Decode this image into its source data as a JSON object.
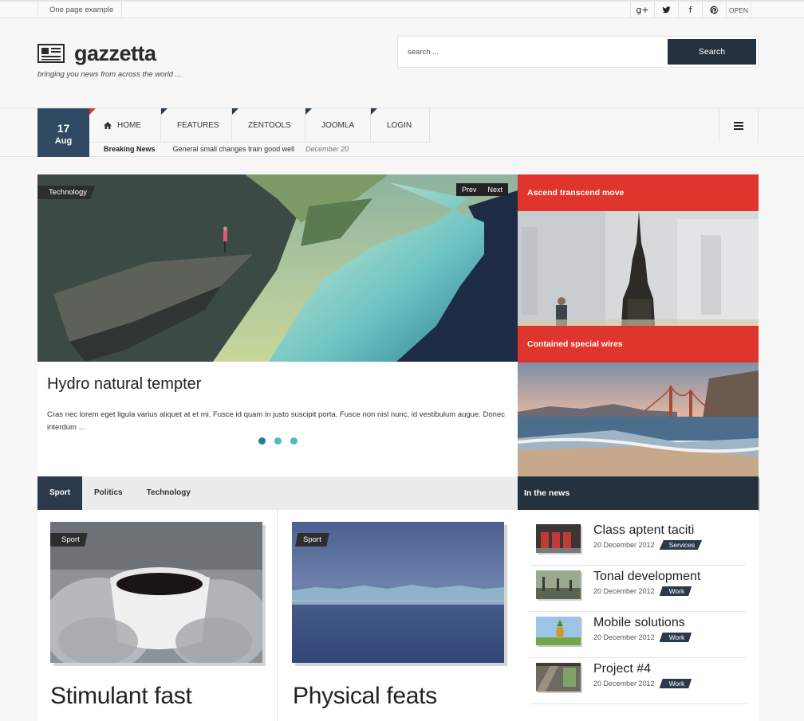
{
  "topbar": {
    "site_label": "One page example",
    "social": [
      {
        "icon": "google-plus-icon",
        "glyph": "g+"
      },
      {
        "icon": "twitter-icon"
      },
      {
        "icon": "facebook-icon",
        "glyph": "f"
      },
      {
        "icon": "pinterest-icon"
      }
    ],
    "open_label": "OPEN"
  },
  "header": {
    "logo_text": "gazzetta",
    "tagline": "bringing you news from across the world ...",
    "search_placeholder": "search ...",
    "search_button": "Search"
  },
  "nav": {
    "date_day": "17",
    "date_month": "Aug",
    "items": [
      "HOME",
      "FEATURES",
      "ZENTOOLS",
      "JOOMLA",
      "LOGIN"
    ],
    "home_icon": "home-icon",
    "menu_icon": "hamburger-icon",
    "breaking_label": "Breaking News",
    "breaking_text": "General small changes train good well",
    "breaking_date": "December 20"
  },
  "slider": {
    "tag": "Technology",
    "prev_label": "Prev",
    "next_label": "Next",
    "title": "Hydro natural tempter",
    "text": "Cras nec lorem eget ligula varius aliquet at et mi. Fusce id quam in justo suscipit porta. Fusce non nisl nunc, id vestibulum augue. Donec interdum ...",
    "dots": 3,
    "active_dot": 0
  },
  "side_features": [
    {
      "title": "Ascend transcend move"
    },
    {
      "title": "Contained special wires"
    }
  ],
  "tabs": {
    "items": [
      "Sport",
      "Politics",
      "Technology"
    ],
    "active": 0
  },
  "cards": [
    {
      "tag": "Sport",
      "title": "Stimulant fast"
    },
    {
      "tag": "Sport",
      "title": "Physical feats"
    }
  ],
  "in_the_news": {
    "heading": "In the news",
    "items": [
      {
        "title": "Class aptent taciti",
        "date": "20 December 2012",
        "category": "Services"
      },
      {
        "title": "Tonal development",
        "date": "20 December 2012",
        "category": "Work"
      },
      {
        "title": "Mobile solutions",
        "date": "20 December 2012",
        "category": "Work"
      },
      {
        "title": "Project #4",
        "date": "20 December 2012",
        "category": "Work"
      }
    ]
  },
  "colors": {
    "accent_red": "#e0352d",
    "dark_navy": "#243240",
    "date_blue": "#2f4a62",
    "dot_teal": "#4fb8c4"
  }
}
